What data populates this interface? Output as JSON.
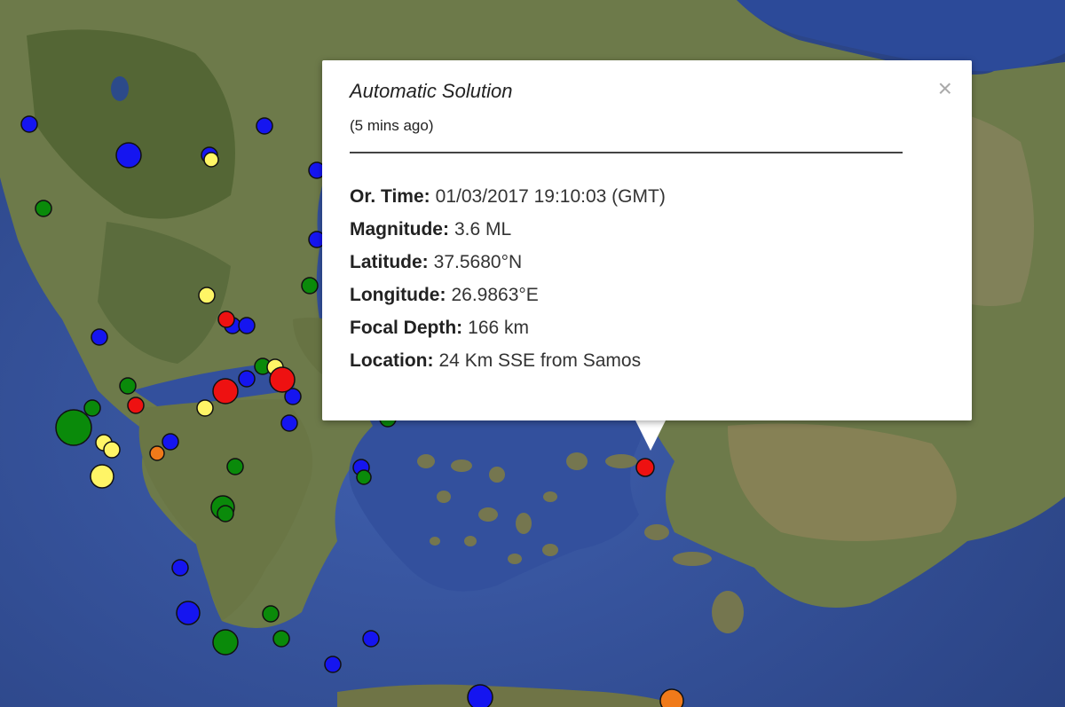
{
  "popup": {
    "title": "Automatic Solution",
    "subtitle": "(5 mins ago)",
    "close_glyph": "×",
    "fields": [
      {
        "label": "Or. Time:",
        "value": "01/03/2017  19:10:03 (GMT)"
      },
      {
        "label": "Magnitude:",
        "value": "3.6 ML"
      },
      {
        "label": "Latitude:",
        "value": "37.5680°N"
      },
      {
        "label": "Longitude:",
        "value": "26.9863°E"
      },
      {
        "label": "Focal Depth:",
        "value": "166 km"
      },
      {
        "label": "Location:",
        "value": "24 Km SSE from Samos"
      }
    ]
  },
  "legend_colors": {
    "red": "#ee1111",
    "blue": "#1515f0",
    "green": "#0a8a0a",
    "yellow": "#fff566",
    "orange": "#f07a1a"
  },
  "earthquake_markers_note_colors": [
    "red",
    "blue",
    "green",
    "yellow",
    "orange"
  ]
}
